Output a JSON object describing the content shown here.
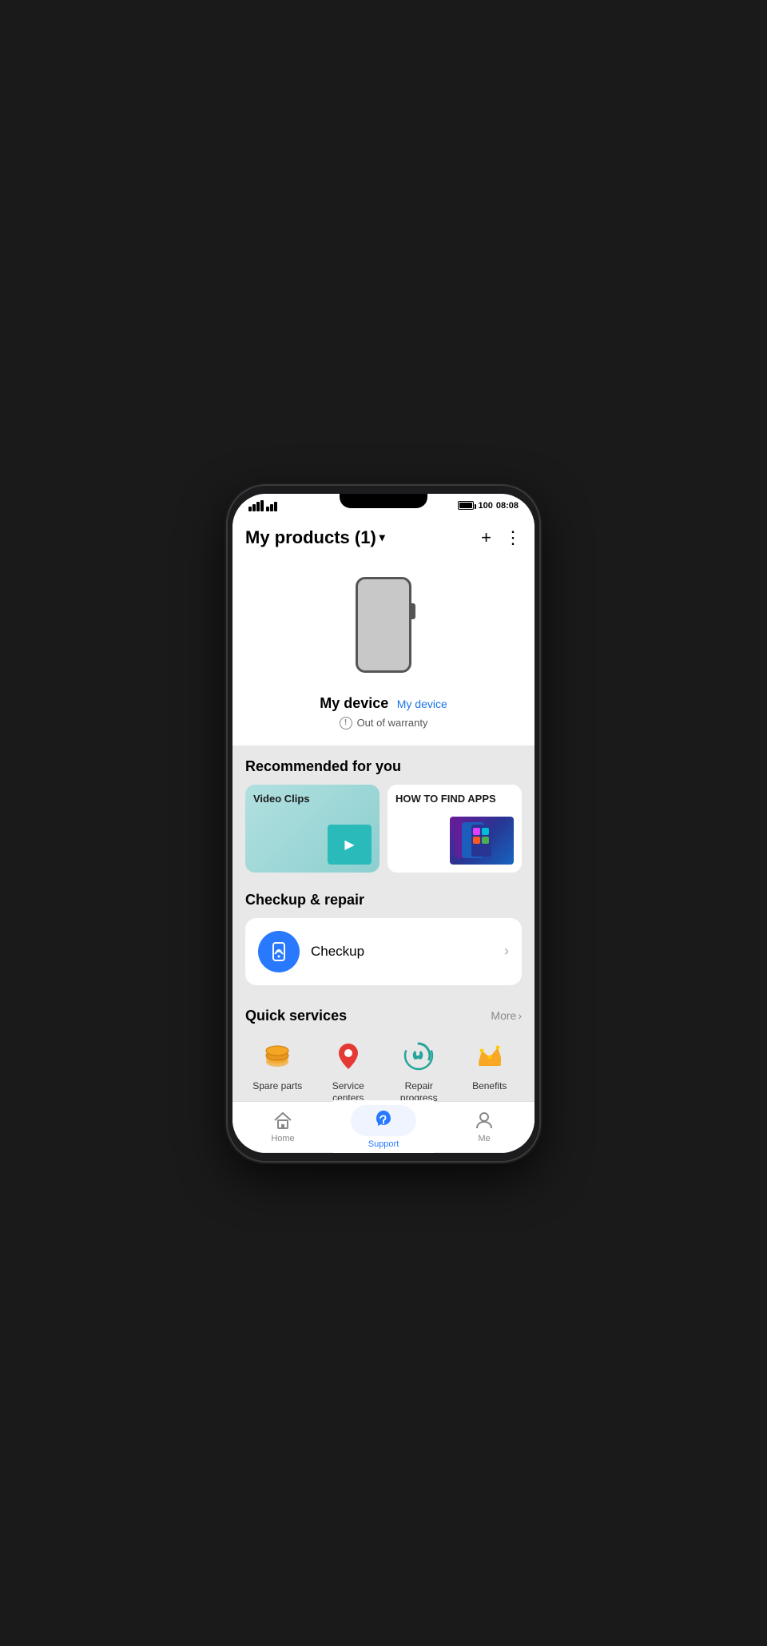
{
  "statusBar": {
    "time": "08:08",
    "battery": "100"
  },
  "header": {
    "title": "My products (1)",
    "addButtonLabel": "+",
    "moreButtonLabel": "⋮"
  },
  "device": {
    "name": "My device",
    "linkLabel": "My device",
    "warrantyStatus": "Out of warranty"
  },
  "recommended": {
    "sectionTitle": "Recommended for you",
    "cards": [
      {
        "label": "Video Clips"
      },
      {
        "label": "HOW TO FIND APPS"
      }
    ]
  },
  "checkupRepair": {
    "sectionTitle": "Checkup & repair",
    "checkupLabel": "Checkup"
  },
  "quickServices": {
    "sectionTitle": "Quick services",
    "moreLabel": "More",
    "items": [
      {
        "id": "spare-parts",
        "label": "Spare parts"
      },
      {
        "id": "service-centers",
        "label": "Service\ncenters"
      },
      {
        "id": "repair-progress",
        "label": "Repair\nprogress"
      },
      {
        "id": "benefits",
        "label": "Benefits"
      }
    ]
  },
  "bottomNav": {
    "items": [
      {
        "id": "home",
        "label": "Home",
        "active": false
      },
      {
        "id": "support",
        "label": "Support",
        "active": true
      },
      {
        "id": "me",
        "label": "Me",
        "active": false
      }
    ]
  }
}
